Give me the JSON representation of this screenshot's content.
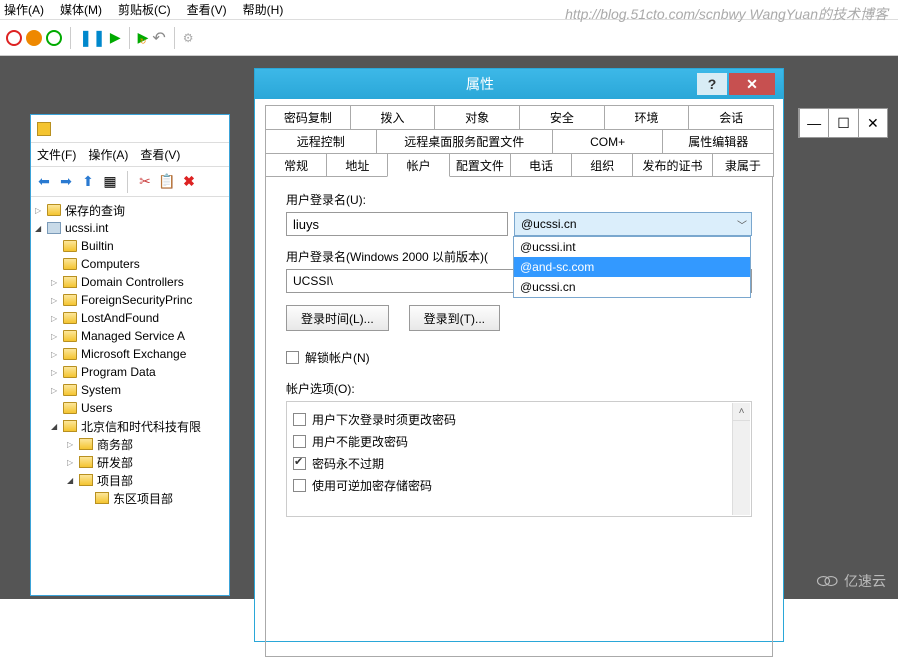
{
  "watermark": "http://blog.51cto.com/scnbwy WangYuan的技术博客",
  "watermark2": "亿速云",
  "top_menu": {
    "items": [
      "操作(A)",
      "媒体(M)",
      "剪贴板(C)",
      "查看(V)",
      "帮助(H)"
    ]
  },
  "mmc": {
    "menu": [
      "文件(F)",
      "操作(A)",
      "查看(V)"
    ],
    "tree": {
      "saved_queries": "保存的查询",
      "domain": "ucssi.int",
      "containers": [
        "Builtin",
        "Computers",
        "Domain Controllers",
        "ForeignSecurityPrinc",
        "LostAndFound",
        "Managed Service A",
        "Microsoft Exchange",
        "Program Data",
        "System",
        "Users"
      ],
      "ou_root": "北京信和时代科技有限",
      "ou_children": [
        "商务部",
        "研发部"
      ],
      "ou_project": "项目部",
      "ou_project_children": [
        "东区项目部"
      ]
    }
  },
  "dialog": {
    "title": "属性",
    "tabs_row1": [
      "密码复制",
      "拨入",
      "对象",
      "安全",
      "环境",
      "会话"
    ],
    "tabs_row2": [
      "远程控制",
      "远程桌面服务配置文件",
      "COM+",
      "属性编辑器"
    ],
    "tabs_row3": [
      "常规",
      "地址",
      "帐户",
      "配置文件",
      "电话",
      "组织",
      "发布的证书",
      "隶属于"
    ],
    "active_tab": "帐户",
    "upn_label": "用户登录名(U):",
    "upn_value": "liuys",
    "upn_suffix_selected": "@ucssi.cn",
    "upn_suffix_options": [
      "@ucssi.int",
      "@and-sc.com",
      "@ucssi.cn"
    ],
    "sam_label": "用户登录名(Windows 2000 以前版本)(",
    "sam_domain": "UCSSI\\",
    "logon_hours_btn": "登录时间(L)...",
    "logon_to_btn": "登录到(T)...",
    "unlock_label": "解锁帐户(N)",
    "options_label": "帐户选项(O):",
    "options": [
      {
        "label": "用户下次登录时须更改密码",
        "checked": false
      },
      {
        "label": "用户不能更改密码",
        "checked": false
      },
      {
        "label": "密码永不过期",
        "checked": true
      },
      {
        "label": "使用可逆加密存储密码",
        "checked": false
      }
    ]
  }
}
